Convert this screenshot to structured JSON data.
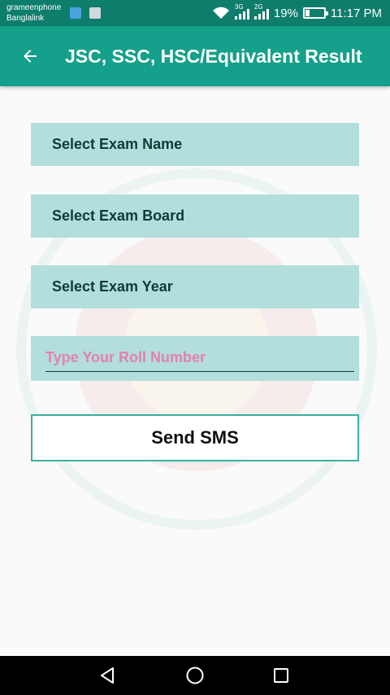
{
  "status_bar": {
    "carrier_1": "grameenphone",
    "carrier_2": "Banglalink",
    "net_1": "3G",
    "net_2": "2G",
    "battery": "19%",
    "time": "11:17 PM"
  },
  "app_bar": {
    "title": "JSC, SSC, HSC/Equivalent Result",
    "back_icon": "arrow-left-icon"
  },
  "form": {
    "exam_name_label": "Select Exam Name",
    "exam_board_label": "Select Exam Board",
    "exam_year_label": "Select Exam Year",
    "roll_value": "",
    "roll_placeholder": "Type Your Roll Number",
    "send_label": "Send SMS"
  },
  "colors": {
    "status_bar": "#0f7d6c",
    "app_bar": "#14a08a",
    "field_bg": "#b2dfdb",
    "field_text": "#0d3b36",
    "placeholder": "#e57fb0",
    "button_border": "#3ab09e"
  },
  "nav_bar": {
    "back_icon": "triangle-back-icon",
    "home_icon": "circle-home-icon",
    "recents_icon": "square-recents-icon"
  }
}
